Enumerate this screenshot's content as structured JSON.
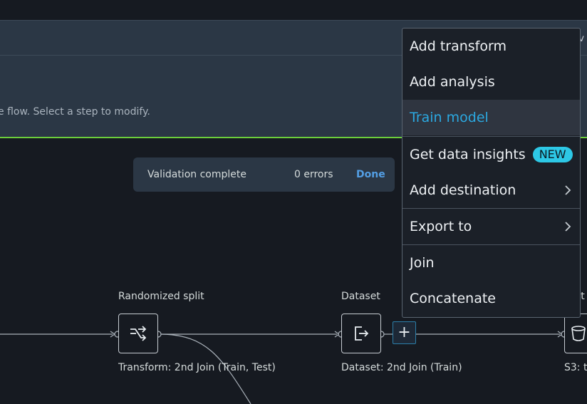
{
  "info_bar": {
    "edge_text": "v"
  },
  "header": {
    "description": "e flow. Select a step to modify."
  },
  "validation": {
    "label": "Validation complete",
    "errors": "0 errors",
    "done": "Done"
  },
  "nodes": {
    "split": {
      "title": "Randomized split",
      "subtitle": "Transform: 2nd Join (Train, Test)",
      "icon": "shuffle-icon"
    },
    "dataset": {
      "title": "Dataset",
      "subtitle": "Dataset: 2nd Join (Train)",
      "icon": "export-icon"
    },
    "s3": {
      "title": "st",
      "subtitle": "S3: t",
      "icon": "bucket-icon"
    }
  },
  "add_button": {
    "label": "+"
  },
  "menu": {
    "items": [
      {
        "label": "Add transform"
      },
      {
        "label": "Add analysis"
      },
      {
        "label": "Train model"
      },
      {
        "label": "Get data insights",
        "badge": "NEW"
      },
      {
        "label": "Add destination"
      },
      {
        "label": "Export to"
      },
      {
        "label": "Join"
      },
      {
        "label": "Concatenate"
      }
    ]
  },
  "colors": {
    "accent_green": "#6ccf3b",
    "active_text": "#2ba8e0",
    "badge_bg": "#2dc8e6",
    "link": "#539fe5"
  }
}
